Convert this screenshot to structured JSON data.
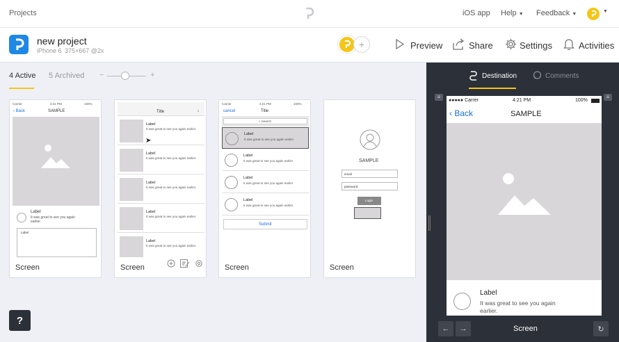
{
  "topbar": {
    "projects_link": "Projects",
    "ios_app": "iOS app",
    "help": "Help",
    "feedback": "Feedback"
  },
  "project": {
    "name": "new project",
    "device": "iPhone 6",
    "dims": "375×667 @2x"
  },
  "actions": {
    "preview": "Preview",
    "share": "Share",
    "settings": "Settings",
    "activities": "Activities"
  },
  "tabs": {
    "active": "4 Active",
    "archived": "5 Archived"
  },
  "zoom": {
    "value": 0.5
  },
  "screens": [
    {
      "label": "Screen",
      "carrier": "Carrier",
      "time": "4:21 PM",
      "battery": "100%",
      "back": "Back",
      "title": "SAMPLE",
      "item_label": "Label",
      "item_sub": "It was great to see you again earlier.",
      "textarea_label": "Label"
    },
    {
      "label": "Screen",
      "title": "Title",
      "rows": [
        {
          "label": "Label",
          "sub": "It was great to see you again earlier."
        },
        {
          "label": "Label",
          "sub": "It was great to see you again earlier."
        },
        {
          "label": "Label",
          "sub": "It was great to see you again earlier."
        },
        {
          "label": "Label",
          "sub": "It was great to see you again earlier."
        },
        {
          "label": "Label",
          "sub": "It was great to see you again earlier."
        }
      ]
    },
    {
      "label": "Screen",
      "carrier": "Carrier",
      "time": "4:21 PM",
      "battery": "100%",
      "cancel": "cancel",
      "title": "Title",
      "search": "Search",
      "rows": [
        {
          "label": "Label",
          "sub": "It was great to see you again earlier"
        },
        {
          "label": "Label",
          "sub": "It was great to see you again earlier"
        },
        {
          "label": "Label",
          "sub": "It was great to see you again earlier"
        },
        {
          "label": "Label",
          "sub": "It was great to see you again earlier"
        }
      ],
      "submit": "Submit"
    },
    {
      "label": "Screen",
      "title": "SAMPLE",
      "email": "email",
      "password": "password",
      "login": "Login"
    }
  ],
  "help_button": "?",
  "panel": {
    "tab_destination": "Destination",
    "tab_comments": "Comments",
    "carrier": "Carrer",
    "time": "4:21 PM",
    "battery": "100%",
    "back": "Back",
    "title": "SAMPLE",
    "item_label": "Label",
    "item_sub": "It was great to see you again earlier.",
    "screen_name": "Screen"
  },
  "colors": {
    "accent": "#f5c518",
    "brand_blue": "#1e88e5",
    "panel_bg": "#2c3038",
    "ios_blue": "#1a6fe0"
  }
}
